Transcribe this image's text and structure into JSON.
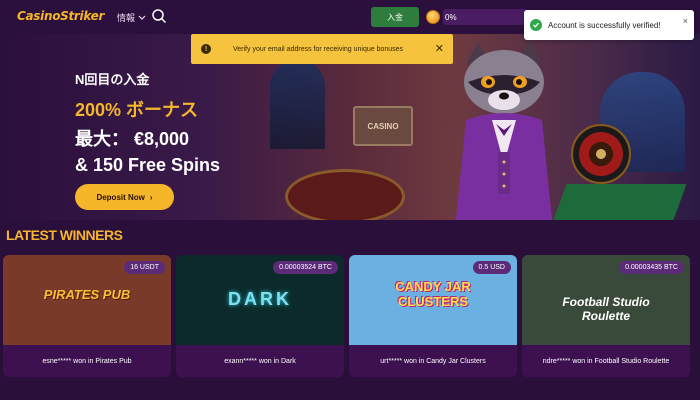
{
  "header": {
    "logo": "CasinoStriker",
    "menu_label": "情報",
    "deposit_label": "入金",
    "progress_text": "0%",
    "progress_value": 0
  },
  "toast": {
    "text": "Account is successfully verified!",
    "close_label": "×"
  },
  "warning": {
    "icon": "!",
    "text": "Verify your email address for receiving unique bonuses",
    "close_label": "✕"
  },
  "hero": {
    "line1": "N回目の入金",
    "line2": "200% ボーナス",
    "line3": "最大： €8,000",
    "line4": "& 150 Free Spins",
    "cta_label": "Deposit Now",
    "cta_arrow": "›",
    "sign_text": "CASINO"
  },
  "latest_winners": {
    "title": "LATEST WINNERS",
    "cards": [
      {
        "amount": "16 USDT",
        "caption": "esne***** won in Pirates Pub",
        "art": "PIRATES PUB",
        "bg": "#7a3a2a"
      },
      {
        "amount": "0.00003524 BTC",
        "caption": "exann***** won in Dark",
        "art": "DARK",
        "bg": "#0d2a2a"
      },
      {
        "amount": "0.5 USD",
        "caption": "urt***** won in Candy Jar Clusters",
        "art": "CANDY JAR CLUSTERS",
        "bg": "#6ab0e0"
      },
      {
        "amount": "0.00003435 BTC",
        "caption": "ndre***** won in Football Studio Roulette",
        "art": "Football Studio Roulette",
        "bg": "#3a4a3a"
      }
    ]
  },
  "colors": {
    "accent": "#f6b62a",
    "background": "#2a0f3b",
    "success": "#2ea84a",
    "warning": "#f5c33d"
  }
}
